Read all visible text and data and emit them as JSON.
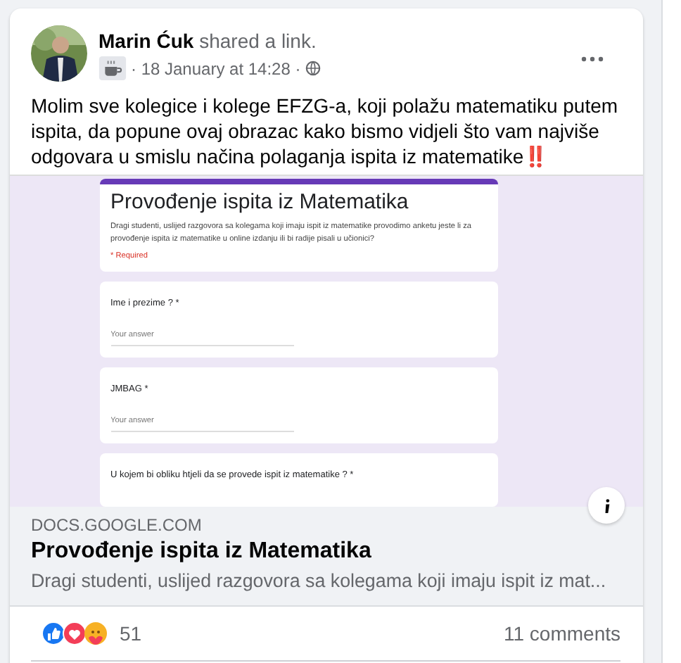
{
  "post": {
    "author": "Marin Ćuk",
    "action": "shared a link.",
    "date": "· 18 January at 14:28 ·",
    "text": "Molim sve kolegice i kolege EFZG-a, koji polažu matematiku putem ispita, da popune ovaj obrazac kako bismo vidjeli što vam najviše odgovara u smislu načina polaganja ispita iz matematike‼️"
  },
  "form": {
    "title": "Provođenje ispita iz Matematika",
    "description": "Dragi studenti, uslijed razgovora sa kolegama koji imaju ispit iz matematike provodimo anketu jeste li za provođenje ispita iz matematike u online izdanju ili bi radije pisali u učionici?",
    "required_note": "* Required",
    "questions": [
      {
        "label": "Ime i prezime ? *",
        "placeholder": "Your answer"
      },
      {
        "label": "JMBAG *",
        "placeholder": "Your answer"
      },
      {
        "label": "U kojem bi obliku htjeli da se provede ispit iz matematike ? *"
      }
    ]
  },
  "link": {
    "domain": "DOCS.GOOGLE.COM",
    "title": "Provođenje ispita iz Matematika",
    "description": "Dragi studenti, uslijed razgovora sa kolegama koji imaju ispit iz mat..."
  },
  "footer": {
    "reaction_count": "51",
    "comments": "11 comments"
  }
}
